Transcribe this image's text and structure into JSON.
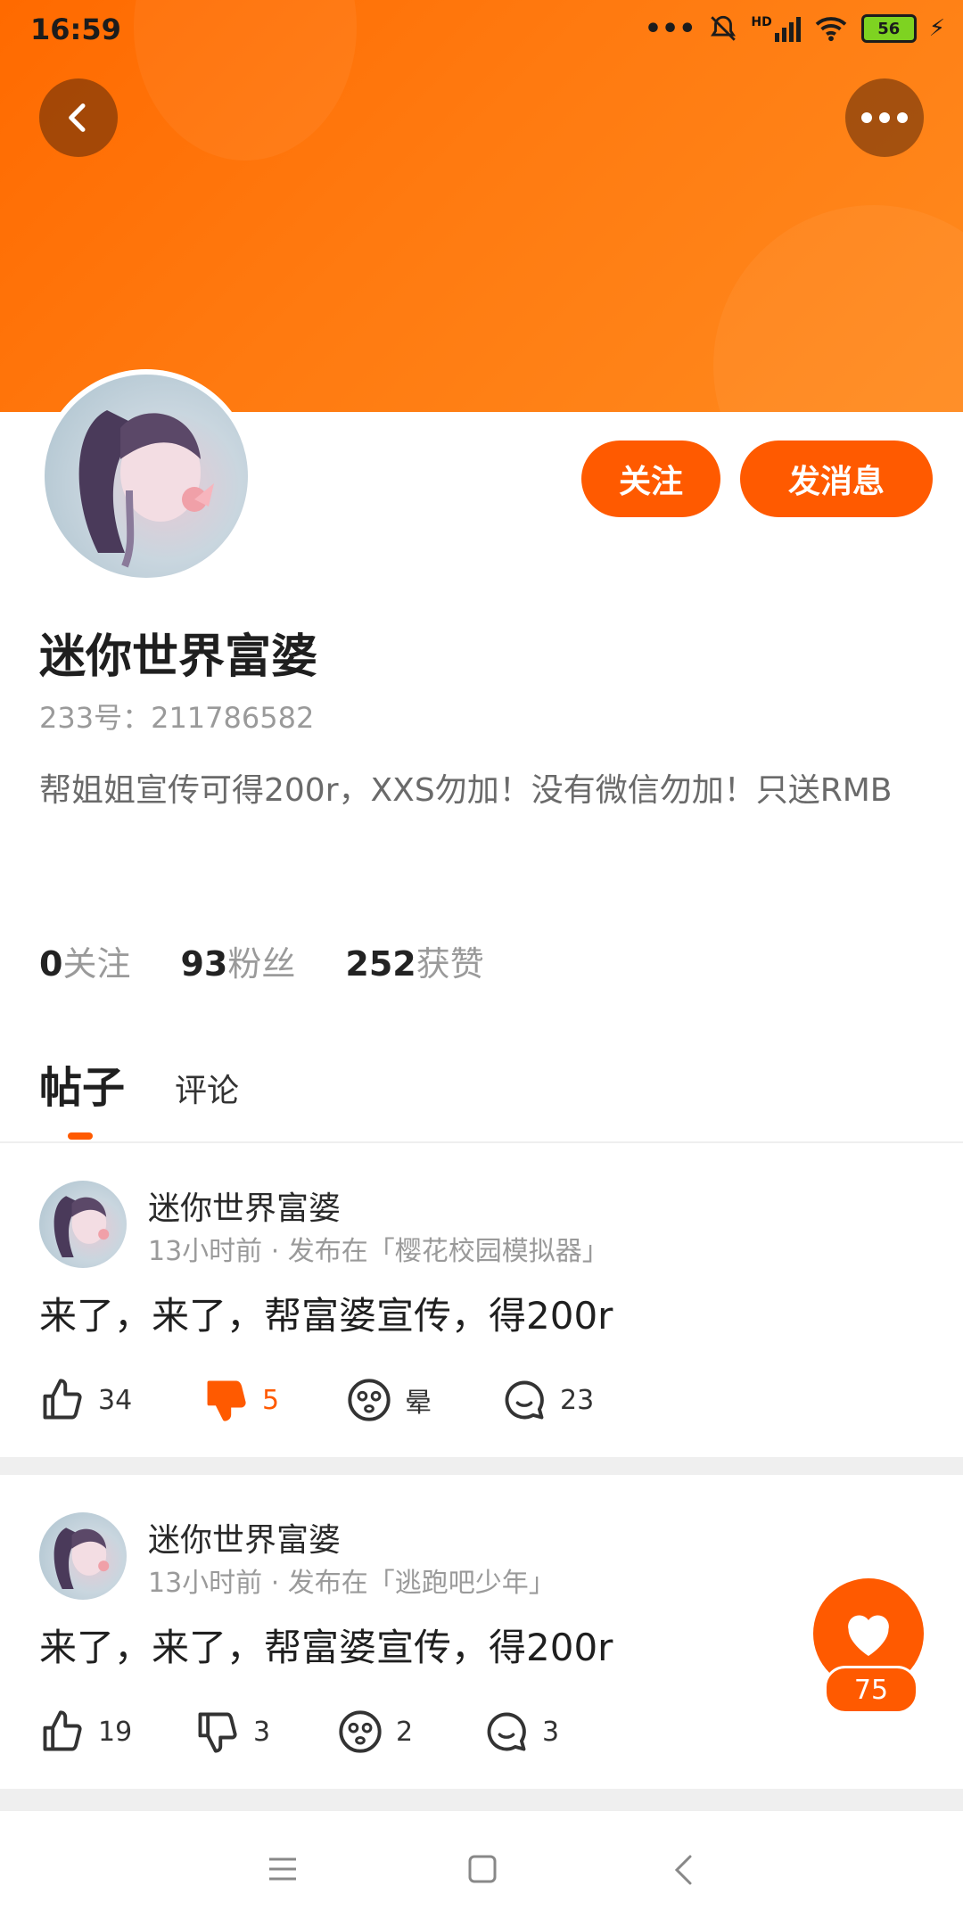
{
  "status_bar": {
    "time": "16:59",
    "signal_label": "HD",
    "battery": "56"
  },
  "header": {
    "back_icon": "chevron-left-icon",
    "more_icon": "more-horizontal-icon"
  },
  "profile": {
    "follow_label": "关注",
    "message_label": "发消息",
    "name": "迷你世界富婆",
    "id_line": "233号：211786582",
    "bio": "帮姐姐宣传可得200r，XXS勿加！没有微信勿加！只送RMB",
    "stats": [
      {
        "num": "0",
        "label": "关注"
      },
      {
        "num": "93",
        "label": "粉丝"
      },
      {
        "num": "252",
        "label": "获赞"
      }
    ]
  },
  "tabs": [
    {
      "label": "帖子",
      "active": true
    },
    {
      "label": "评论",
      "active": false
    }
  ],
  "posts": [
    {
      "author": "迷你世界富婆",
      "meta": "13小时前 · 发布在「樱花校园模拟器」",
      "text": "来了，来了，帮富婆宣传，得200r",
      "likes": "34",
      "dislikes": "5",
      "dizzy": "晕",
      "comments": "23"
    },
    {
      "author": "迷你世界富婆",
      "meta": "13小时前 · 发布在「逃跑吧少年」",
      "text": "来了，来了，帮富婆宣传，得200r",
      "likes": "19",
      "dislikes": "3",
      "dizzy": "2",
      "comments": "3"
    }
  ],
  "fab": {
    "count": "75"
  },
  "colors": {
    "accent": "#ff5a00",
    "banner": "#ff7a10"
  }
}
